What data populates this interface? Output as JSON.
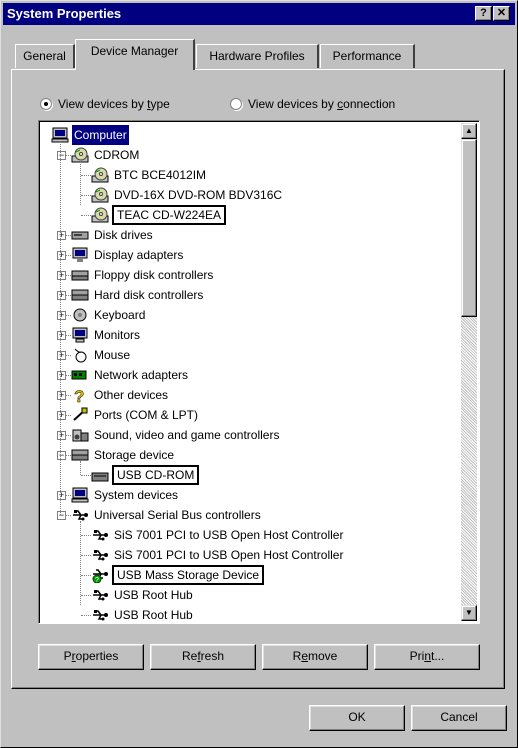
{
  "window": {
    "title": "System Properties",
    "help_btn": "?",
    "close_btn": "✕"
  },
  "tabs": [
    {
      "label": "General",
      "active": false
    },
    {
      "label": "Device Manager",
      "active": true
    },
    {
      "label": "Hardware Profiles",
      "active": false
    },
    {
      "label": "Performance",
      "active": false
    }
  ],
  "view_options": {
    "by_type": {
      "pre": "View devices by ",
      "u": "t",
      "post": "ype",
      "selected": true
    },
    "by_connection": {
      "pre": "View devices by ",
      "u": "c",
      "post": "onnection",
      "selected": false
    }
  },
  "tree": [
    {
      "label": "Computer",
      "icon": "computer-icon",
      "selected": true
    },
    {
      "label": "CDROM",
      "icon": "cdrom-icon"
    },
    {
      "label": "BTC BCE4012IM",
      "icon": "cdrom-icon"
    },
    {
      "label": "DVD-16X DVD-ROM BDV316C",
      "icon": "cdrom-icon"
    },
    {
      "label": "TEAC CD-W224EA",
      "icon": "cdrom-icon",
      "boxed": true
    },
    {
      "label": "Disk drives",
      "icon": "disk-drive-icon"
    },
    {
      "label": "Display adapters",
      "icon": "display-adapter-icon"
    },
    {
      "label": "Floppy disk controllers",
      "icon": "floppy-controller-icon"
    },
    {
      "label": "Hard disk controllers",
      "icon": "hard-disk-controller-icon"
    },
    {
      "label": "Keyboard",
      "icon": "keyboard-icon"
    },
    {
      "label": "Monitors",
      "icon": "monitor-icon"
    },
    {
      "label": "Mouse",
      "icon": "mouse-icon"
    },
    {
      "label": "Network adapters",
      "icon": "network-adapter-icon"
    },
    {
      "label": "Other devices",
      "icon": "question-mark-icon"
    },
    {
      "label": "Ports (COM & LPT)",
      "icon": "port-icon"
    },
    {
      "label": "Sound, video and game controllers",
      "icon": "sound-icon"
    },
    {
      "label": "Storage device",
      "icon": "storage-icon"
    },
    {
      "label": "USB CD-ROM",
      "icon": "storage-device-icon",
      "boxed": true
    },
    {
      "label": "System devices",
      "icon": "system-device-icon"
    },
    {
      "label": "Universal Serial Bus controllers",
      "icon": "usb-icon"
    },
    {
      "label": "SiS 7001 PCI to USB Open Host Controller",
      "icon": "usb-icon"
    },
    {
      "label": "SiS 7001 PCI to USB Open Host Controller",
      "icon": "usb-icon"
    },
    {
      "label": "USB Mass Storage Device",
      "icon": "usb-storage-icon",
      "boxed": true
    },
    {
      "label": "USB Root Hub",
      "icon": "usb-icon"
    },
    {
      "label": "USB Root Hub",
      "icon": "usb-icon"
    }
  ],
  "buttons": {
    "properties": {
      "pre": "P",
      "u": "r",
      "post": "operties"
    },
    "refresh": {
      "pre": "Re",
      "u": "f",
      "post": "resh"
    },
    "remove": {
      "pre": "R",
      "u": "e",
      "post": "move"
    },
    "print": {
      "pre": "Pri",
      "u": "n",
      "post": "t..."
    },
    "ok": "OK",
    "cancel": "Cancel"
  },
  "colors": {
    "title_bar": "#000080",
    "face": "#c0c0c0",
    "selection": "#000080"
  }
}
